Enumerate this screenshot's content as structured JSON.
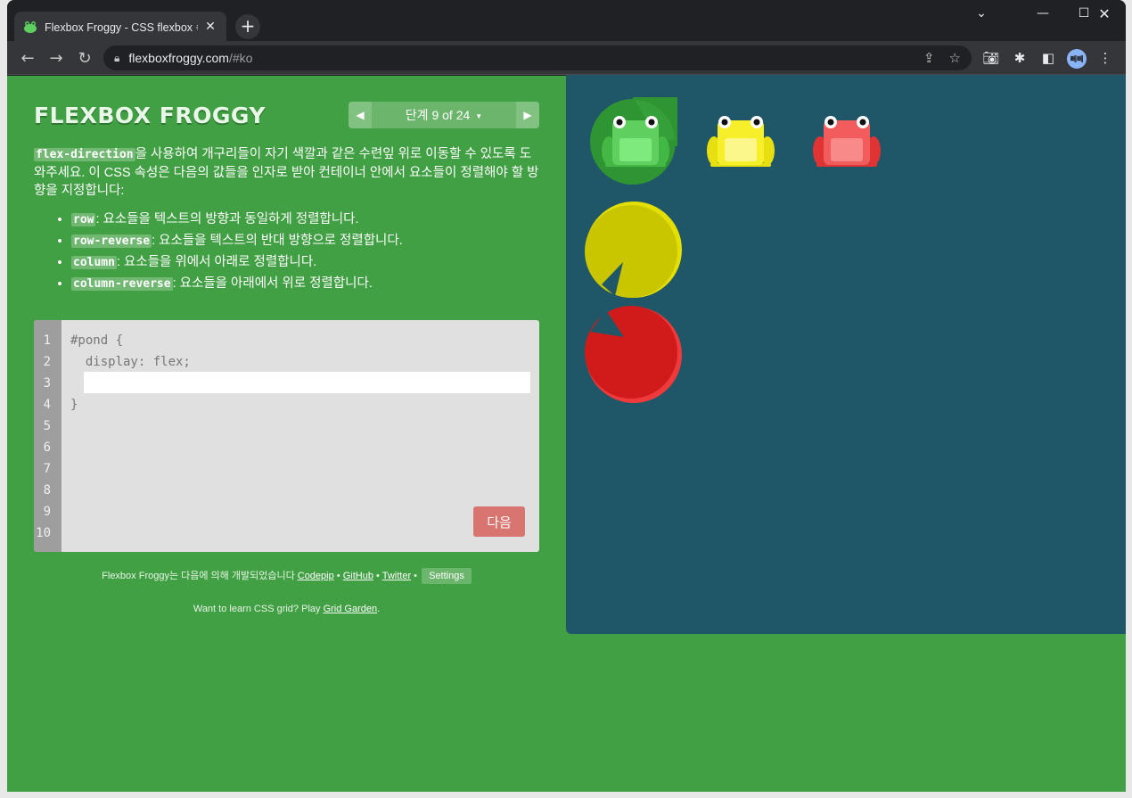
{
  "browser": {
    "tab_title": "Flexbox Froggy - CSS flexbox 속",
    "tab_close": "✕",
    "new_tab": "+",
    "url_host": "flexboxfroggy.com",
    "url_path": "/#ko",
    "profile_initials": "뻬뻬"
  },
  "game": {
    "logo": "FLEXBOX FROGGY",
    "level_indicator": "단계 9 of 24",
    "instructions": {
      "code_term": "flex-direction",
      "text": "을 사용하여 개구리들이 자기 색깔과 같은 수련잎 위로 이동할 수 있도록 도와주세요. 이 CSS 속성은 다음의 값들을 인자로 받아 컨테이너 안에서 요소들이 정렬해야 할 방향을 지정합니다:"
    },
    "bullets": [
      {
        "code": "row",
        "text": ": 요소들을 텍스트의 방향과 동일하게 정렬합니다."
      },
      {
        "code": "row-reverse",
        "text": ": 요소들을 텍스트의 반대 방향으로 정렬합니다."
      },
      {
        "code": "column",
        "text": ": 요소들을 위에서 아래로 정렬합니다."
      },
      {
        "code": "column-reverse",
        "text": ": 요소들을 아래에서 위로 정렬합니다."
      }
    ],
    "editor": {
      "line_numbers": [
        "1",
        "2",
        "3",
        "4",
        "5",
        "6",
        "7",
        "8",
        "9",
        "10"
      ],
      "line1": "#pond {",
      "line2": "  display: flex;",
      "line4": "}",
      "input_value": "",
      "next_label": "다음"
    },
    "credits": {
      "prefix": "Flexbox Froggy는 다음에 의해 개발되었습니다 ",
      "codepip": "Codepip",
      "github": "GitHub",
      "twitter": "Twitter",
      "sep": " • ",
      "settings": "Settings"
    },
    "grid_garden": {
      "prefix": "Want to learn CSS grid? Play ",
      "link": "Grid Garden",
      "suffix": "."
    }
  },
  "colors": {
    "page_bg": "#42a044",
    "pond_bg": "#1f5768",
    "green_frog": "#5fcf5f",
    "yellow_frog": "#f7ef2a",
    "red_frog": "#f25c5c",
    "green_pad": "#2e9532",
    "yellow_pad": "#c9c600",
    "red_pad": "#d11a1a"
  }
}
